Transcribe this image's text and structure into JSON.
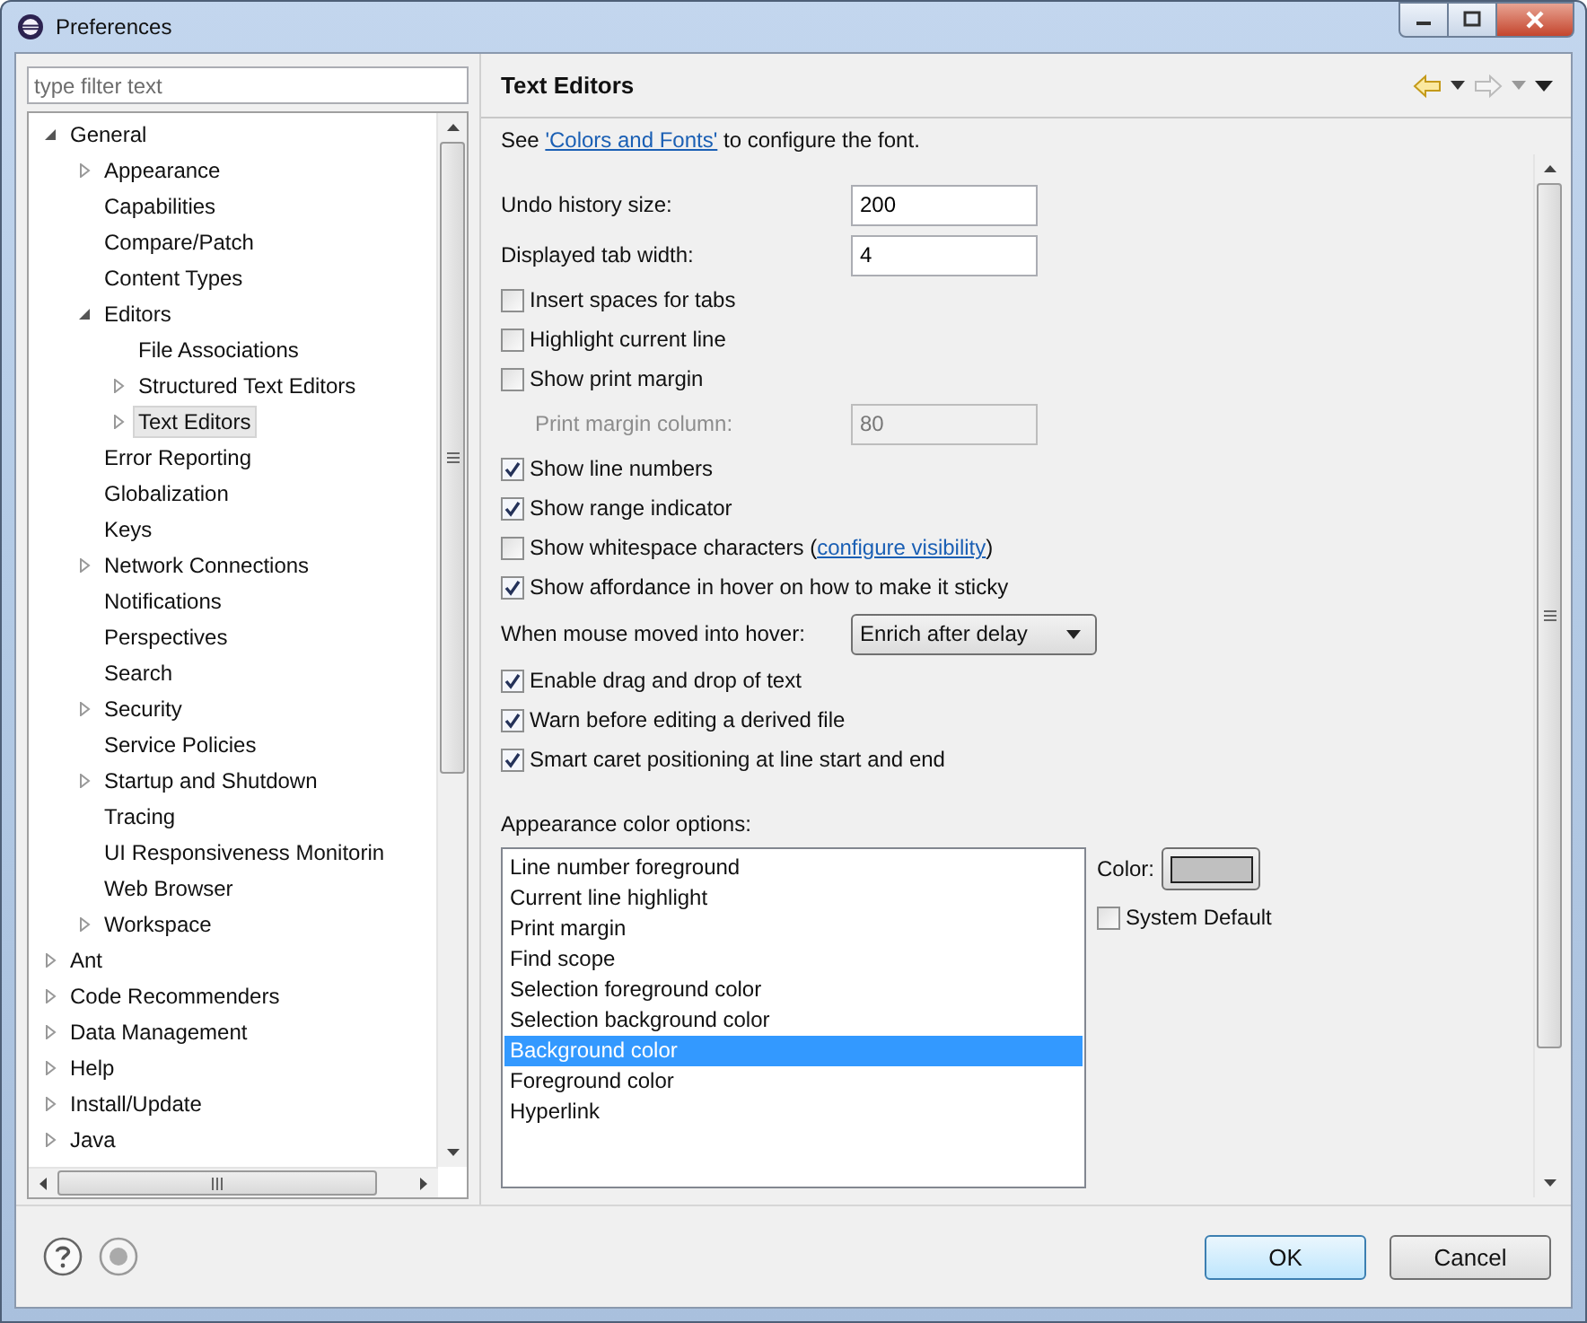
{
  "window": {
    "title": "Preferences"
  },
  "filter": {
    "placeholder": "type filter text"
  },
  "tree": [
    {
      "label": "General",
      "expanded": true,
      "selected": false,
      "children": [
        {
          "label": "Appearance",
          "expanded": false,
          "selected": false
        },
        {
          "label": "Capabilities",
          "selected": false
        },
        {
          "label": "Compare/Patch",
          "selected": false
        },
        {
          "label": "Content Types",
          "selected": false
        },
        {
          "label": "Editors",
          "expanded": true,
          "selected": false,
          "children": [
            {
              "label": "File Associations",
              "selected": false
            },
            {
              "label": "Structured Text Editors",
              "expanded": false,
              "selected": false
            },
            {
              "label": "Text Editors",
              "expanded": false,
              "selected": true
            }
          ]
        },
        {
          "label": "Error Reporting",
          "selected": false
        },
        {
          "label": "Globalization",
          "selected": false
        },
        {
          "label": "Keys",
          "selected": false
        },
        {
          "label": "Network Connections",
          "expanded": false,
          "selected": false
        },
        {
          "label": "Notifications",
          "selected": false
        },
        {
          "label": "Perspectives",
          "selected": false
        },
        {
          "label": "Search",
          "selected": false
        },
        {
          "label": "Security",
          "expanded": false,
          "selected": false
        },
        {
          "label": "Service Policies",
          "selected": false
        },
        {
          "label": "Startup and Shutdown",
          "expanded": false,
          "selected": false
        },
        {
          "label": "Tracing",
          "selected": false
        },
        {
          "label": "UI Responsiveness Monitorin",
          "selected": false
        },
        {
          "label": "Web Browser",
          "selected": false
        },
        {
          "label": "Workspace",
          "expanded": false,
          "selected": false
        }
      ]
    },
    {
      "label": "Ant",
      "expanded": false,
      "selected": false
    },
    {
      "label": "Code Recommenders",
      "expanded": false,
      "selected": false
    },
    {
      "label": "Data Management",
      "expanded": false,
      "selected": false
    },
    {
      "label": "Help",
      "expanded": false,
      "selected": false
    },
    {
      "label": "Install/Update",
      "expanded": false,
      "selected": false
    },
    {
      "label": "Java",
      "expanded": false,
      "selected": false
    }
  ],
  "page": {
    "title": "Text Editors",
    "intro_before": "See ",
    "intro_link": "'Colors and Fonts'",
    "intro_after": " to configure the font."
  },
  "settings": [
    {
      "kind": "number",
      "label": "Undo history size:",
      "value": "200",
      "disabled": false
    },
    {
      "kind": "number",
      "label": "Displayed tab width:",
      "value": "4",
      "disabled": false
    },
    {
      "kind": "checkbox",
      "label": "Insert spaces for tabs",
      "checked": false
    },
    {
      "kind": "checkbox",
      "label": "Highlight current line",
      "checked": false
    },
    {
      "kind": "checkbox",
      "label": "Show print margin",
      "checked": false,
      "children": [
        {
          "kind": "number",
          "label": "Print margin column:",
          "value": "80",
          "disabled": true
        }
      ]
    },
    {
      "kind": "checkbox",
      "label": "Show line numbers",
      "checked": true
    },
    {
      "kind": "checkbox",
      "label": "Show range indicator",
      "checked": true
    },
    {
      "kind": "checkbox",
      "label": "Show whitespace characters (",
      "link": "configure visibility",
      "label_after": ")",
      "checked": false
    },
    {
      "kind": "checkbox",
      "label": "Show affordance in hover on how to make it sticky",
      "checked": true
    },
    {
      "kind": "select",
      "label": "When mouse moved into hover:",
      "value": "Enrich after delay"
    },
    {
      "kind": "checkbox",
      "label": "Enable drag and drop of text",
      "checked": true
    },
    {
      "kind": "checkbox",
      "label": "Warn before editing a derived file",
      "checked": true
    },
    {
      "kind": "checkbox",
      "label": "Smart caret positioning at line start and end",
      "checked": true
    }
  ],
  "appearance": {
    "label": "Appearance color options:",
    "items": [
      {
        "label": "Line number foreground",
        "selected": false
      },
      {
        "label": "Current line highlight",
        "selected": false
      },
      {
        "label": "Print margin",
        "selected": false
      },
      {
        "label": "Find scope",
        "selected": false
      },
      {
        "label": "Selection foreground color",
        "selected": false
      },
      {
        "label": "Selection background color",
        "selected": false
      },
      {
        "label": "Background color",
        "selected": true
      },
      {
        "label": "Foreground color",
        "selected": false
      },
      {
        "label": "Hyperlink",
        "selected": false
      }
    ],
    "color_label": "Color:",
    "color": "#c0c0c0",
    "system_default": {
      "label": "System Default",
      "checked": false
    }
  },
  "buttons": [
    {
      "label": "OK",
      "default": true
    },
    {
      "label": "Cancel",
      "default": false
    }
  ]
}
